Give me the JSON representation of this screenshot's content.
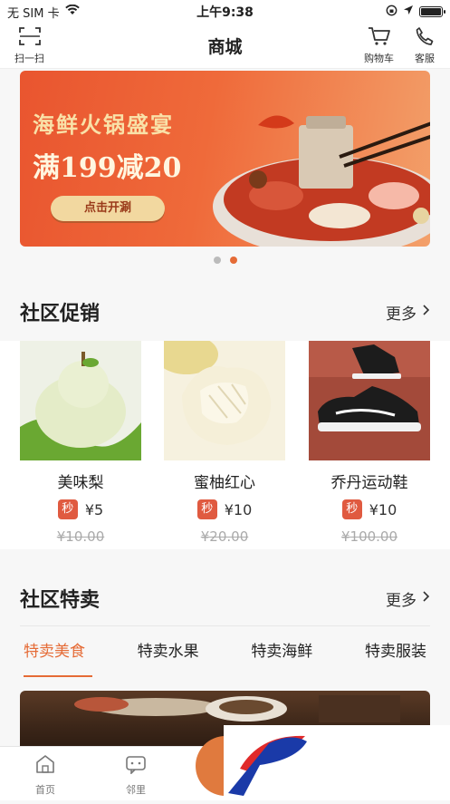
{
  "status": {
    "carrier": "无 SIM 卡",
    "time": "上午9:38"
  },
  "nav": {
    "scan_label": "扫一扫",
    "title": "商城",
    "cart_label": "购物车",
    "service_label": "客服"
  },
  "banner": {
    "title": "海鲜火锅盛宴",
    "subtitle": "满199减20",
    "button": "点击开涮",
    "slide_count": 2,
    "active_slide": 2
  },
  "promo_section": {
    "title": "社区促销",
    "more": "更多",
    "items": [
      {
        "name": "美味梨",
        "badge": "秒",
        "price": "¥5",
        "original_price": "¥10.00"
      },
      {
        "name": "蜜柚红心",
        "badge": "秒",
        "price": "¥10",
        "original_price": "¥20.00"
      },
      {
        "name": "乔丹运动鞋",
        "badge": "秒",
        "price": "¥10",
        "original_price": "¥100.00"
      }
    ]
  },
  "special_section": {
    "title": "社区特卖",
    "more": "更多",
    "tabs": [
      "特卖美食",
      "特卖水果",
      "特卖海鲜",
      "特卖服装"
    ],
    "active_tab": 0
  },
  "tabbar": {
    "items": [
      {
        "label": "首页",
        "icon": "home-icon"
      },
      {
        "label": "邻里",
        "icon": "chat-icon"
      }
    ]
  },
  "colors": {
    "accent": "#e56b36",
    "badge": "#e05a40"
  }
}
